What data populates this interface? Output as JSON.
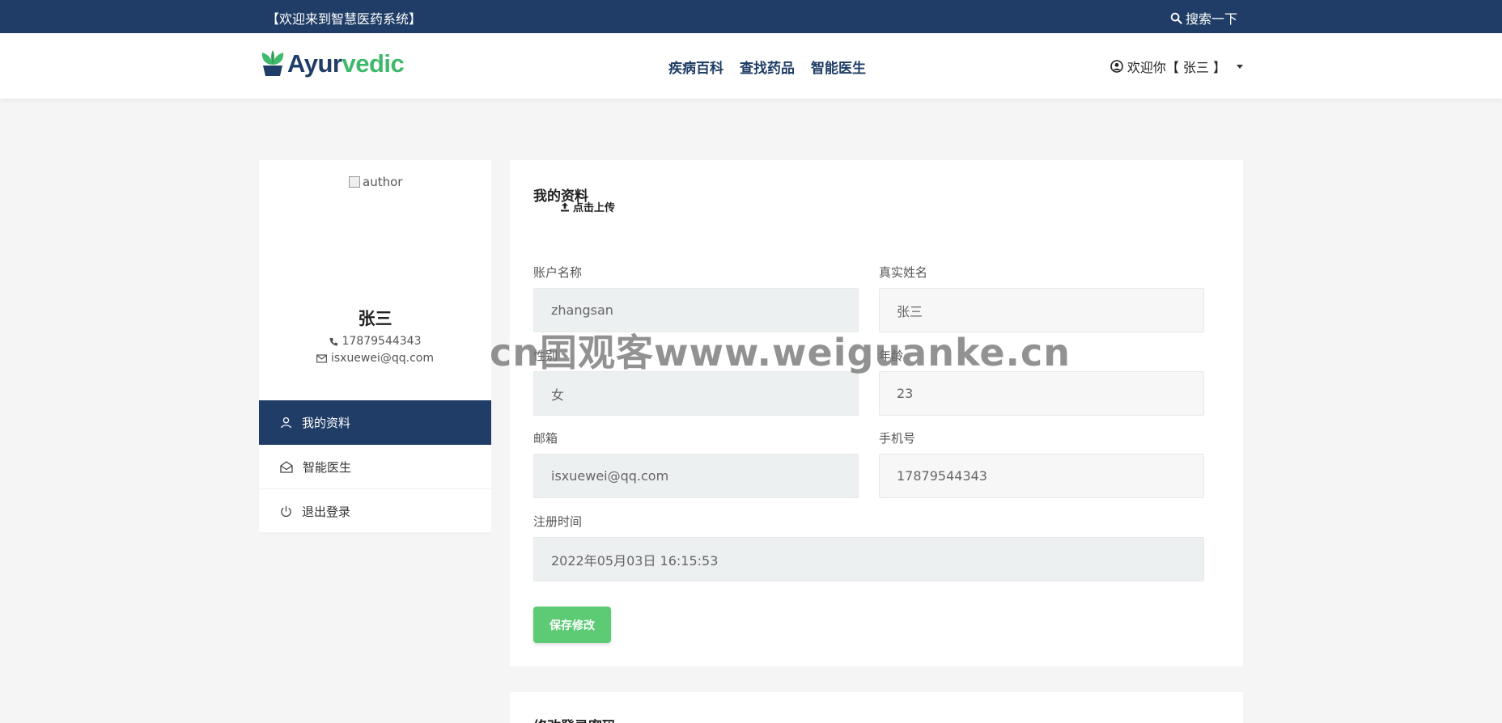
{
  "topbar": {
    "welcome": "【欢迎来到智慧医药系统】",
    "search_label": "搜索一下"
  },
  "header": {
    "logo_part1": "Ayur",
    "logo_part2": "vedic",
    "nav": [
      "疾病百科",
      "查找药品",
      "智能医生"
    ],
    "user_menu": "欢迎你【 张三 】"
  },
  "colors": {
    "primary": "#1f3d66",
    "accent": "#3fb96b",
    "save_button": "#5ccb73"
  },
  "sidebar": {
    "avatar_alt": "author",
    "name": "张三",
    "phone": "17879544343",
    "email": "isxuewei@qq.com",
    "menu": [
      {
        "label": "我的资料",
        "icon": "user-icon",
        "active": true
      },
      {
        "label": "智能医生",
        "icon": "envelope-open-icon",
        "active": false
      },
      {
        "label": "退出登录",
        "icon": "power-icon",
        "active": false
      }
    ]
  },
  "profile": {
    "title": "我的资料",
    "upload_label": "点击上传",
    "fields": {
      "account": {
        "label": "账户名称",
        "value": "zhangsan"
      },
      "real_name": {
        "label": "真实姓名",
        "value": "张三"
      },
      "gender": {
        "label": "性别",
        "value": "女"
      },
      "age": {
        "label": "年龄",
        "value": "23"
      },
      "email": {
        "label": "邮箱",
        "value": "isxuewei@qq.com"
      },
      "phone": {
        "label": "手机号",
        "value": "17879544343"
      },
      "register_time": {
        "label": "注册时间",
        "value": "2022年05月03日 16:15:53"
      }
    },
    "save_label": "保存修改"
  },
  "password_card": {
    "title": "修改登录密码"
  },
  "watermark": "cn国观客www.weiguanke.cn"
}
